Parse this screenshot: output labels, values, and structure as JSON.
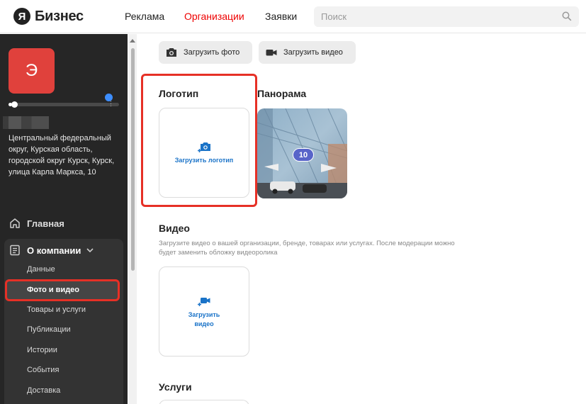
{
  "header": {
    "logo_letter": "Я",
    "logo_text": "Бизнес",
    "nav": [
      "Реклама",
      "Организации",
      "Заявки"
    ],
    "search_placeholder": "Поиск"
  },
  "sidebar": {
    "avatar_letter": "Э",
    "profile_completion": 0.03,
    "address": "Центральный федеральный округ, Курская область, городской округ Курск, Курск, улица Карла Маркса, 10",
    "main_label": "Главная",
    "about_label": "О компании",
    "sub_items": [
      "Данные",
      "Фото и видео",
      "Товары и услуги",
      "Публикации",
      "Истории",
      "События",
      "Доставка"
    ]
  },
  "content": {
    "upload_photo": "Загрузить фото",
    "upload_video_btn": "Загрузить видео",
    "logo_title": "Логотип",
    "upload_logo": "Загрузить логотип",
    "panorama_title": "Панорама",
    "panorama_badge": "10",
    "video_title": "Видео",
    "video_desc": "Загрузите видео о вашей организации, бренде, товарах или услугах. После модерации можно будет заменить обложку видеоролика",
    "upload_video_card_line1": "Загрузить",
    "upload_video_card_line2": "видео",
    "services_title": "Услуги"
  },
  "colors": {
    "accent_red": "#e00000",
    "highlight": "#e63026",
    "link_blue": "#1a73c8",
    "avatar": "#e0413c"
  }
}
